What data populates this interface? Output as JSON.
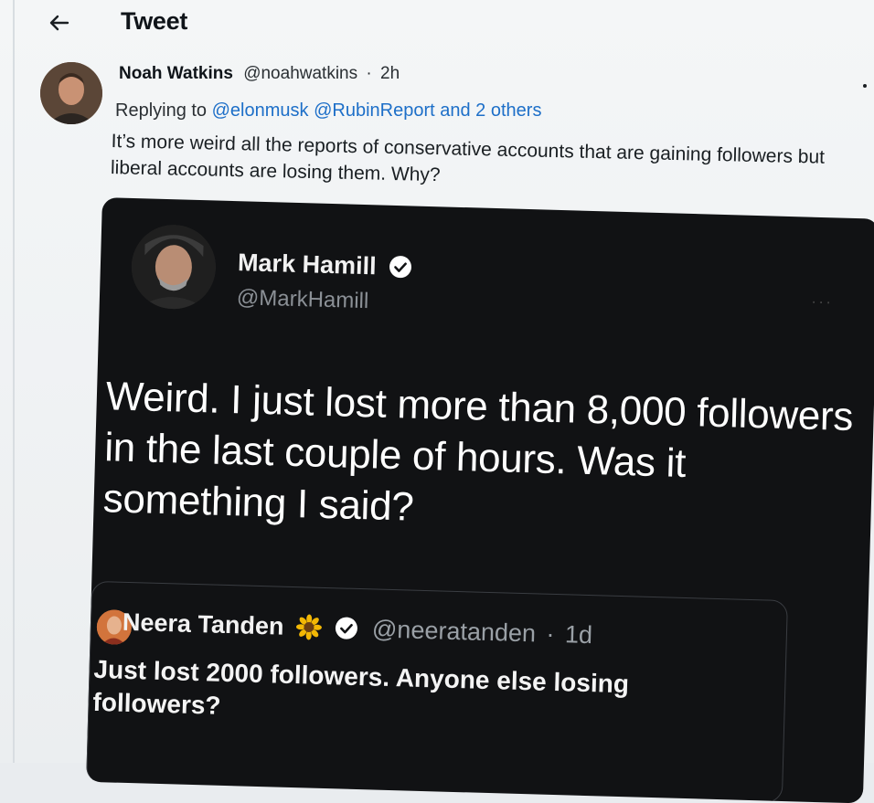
{
  "header": {
    "title": "Tweet"
  },
  "reply": {
    "name": "Noah Watkins",
    "handle": "@noahwatkins",
    "separator": "·",
    "time": "2h",
    "replying_prefix": "Replying to",
    "mention_1": "@elonmusk",
    "mention_2": "@RubinReport",
    "and_others": "and 2 others",
    "text": "It’s more weird all the reports of conservative accounts that are gaining followers but liberal accounts are losing them. Why?"
  },
  "quoted_card": {
    "name": "Mark Hamill",
    "handle": "@MarkHamill",
    "text": "Weird. I just lost more than 8,000 followers in the last couple of hours. Was it something I said?",
    "inner_quote": {
      "name": "Neera Tanden",
      "handle": "@neeratanden",
      "separator": "·",
      "time": "1d",
      "text": "Just lost 2000 followers.  Anyone else losing followers?"
    }
  },
  "colors": {
    "link": "#1d6fc8",
    "card_bg": "#111214",
    "verified": "#ffffff"
  },
  "icons": [
    "back-arrow-icon",
    "verified-icon",
    "sunflower-icon",
    "more-icon"
  ]
}
